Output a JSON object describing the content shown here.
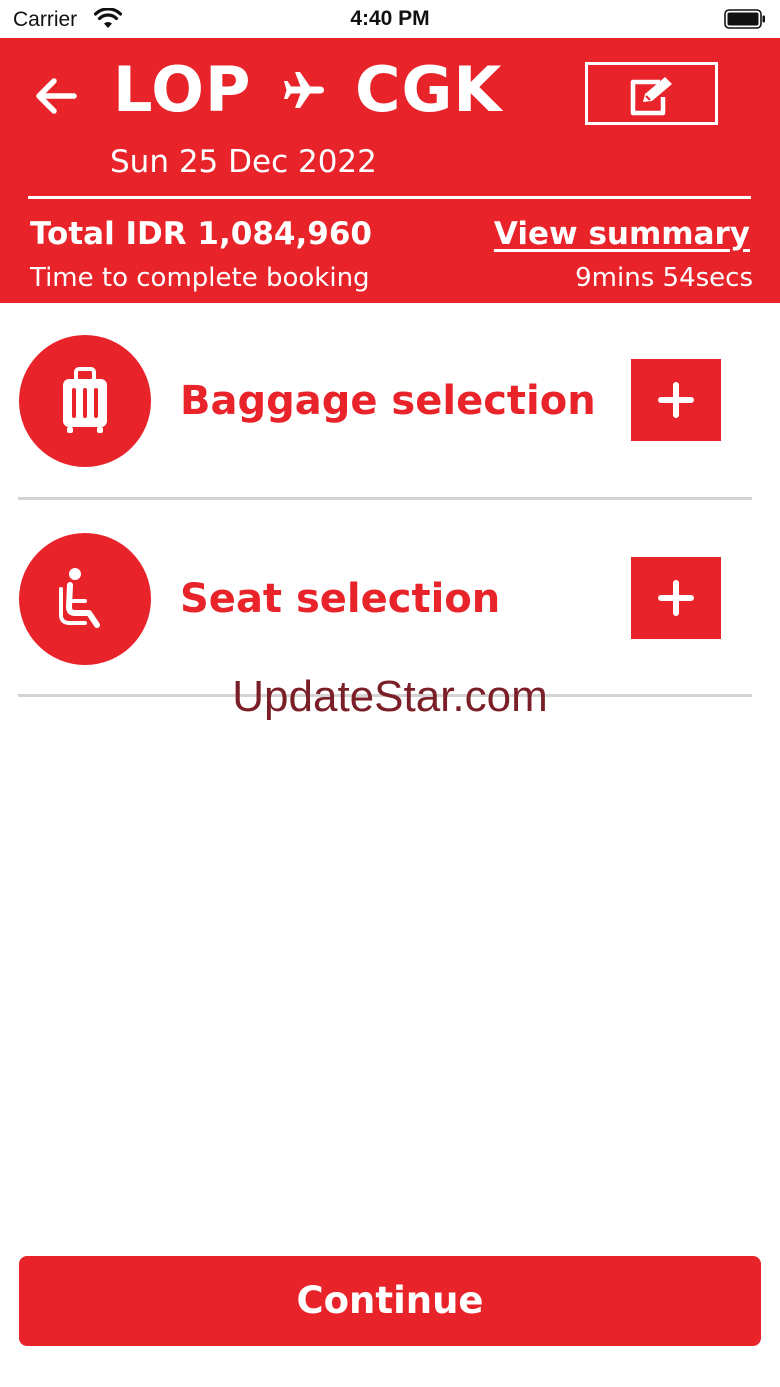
{
  "status_bar": {
    "carrier": "Carrier",
    "time": "4:40 PM",
    "icons": [
      "wifi-icon",
      "battery-icon"
    ]
  },
  "header": {
    "origin": "LOP",
    "destination": "CGK",
    "date": "Sun 25 Dec 2022",
    "total": "Total IDR 1,084,960",
    "view_summary": "View summary",
    "timer_label": "Time to complete booking",
    "timer_value": "9mins 54secs",
    "icons": [
      "back-arrow-icon",
      "plane-icon",
      "edit-icon"
    ]
  },
  "sections": [
    {
      "title": "Baggage selection",
      "icon": "luggage-icon",
      "action_icon": "plus-icon"
    },
    {
      "title": "Seat selection",
      "icon": "seat-icon",
      "action_icon": "plus-icon"
    }
  ],
  "watermark": "UpdateStar.com",
  "footer": {
    "continue_label": "Continue"
  },
  "colors": {
    "brand_red": "#e8232a",
    "divider_gray": "#d4d4d4",
    "watermark": "#7a1e28"
  }
}
